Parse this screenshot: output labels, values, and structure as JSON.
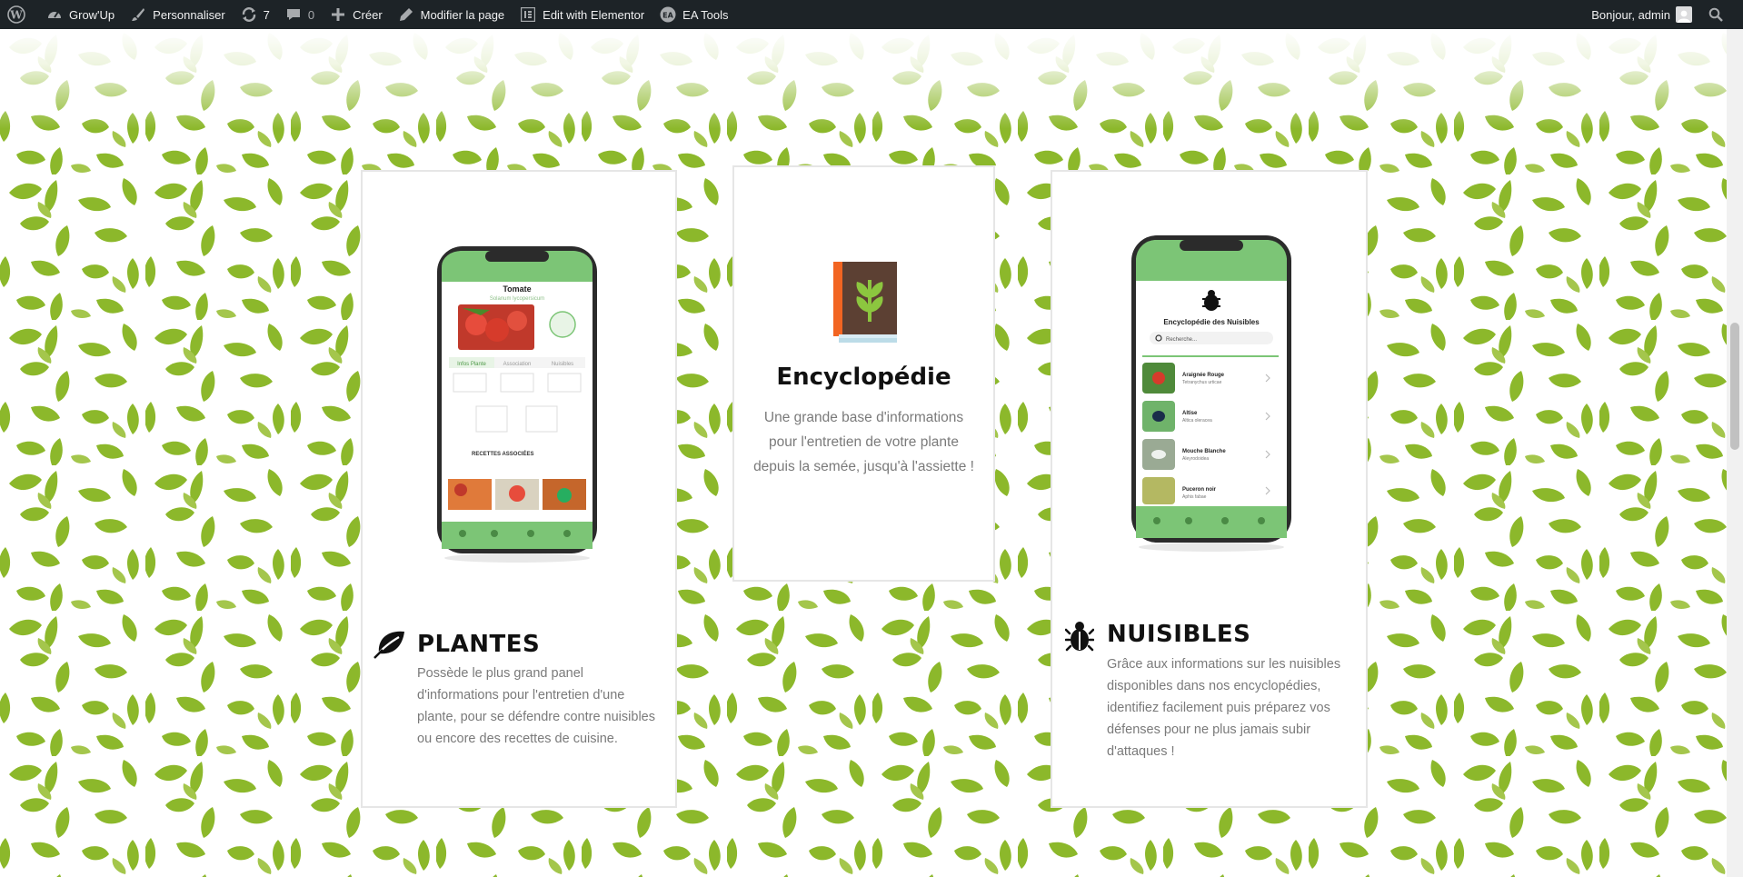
{
  "adminbar": {
    "site_name": "Grow'Up",
    "customize": "Personnaliser",
    "updates_count": "7",
    "comments_count": "0",
    "new": "Créer",
    "edit_page": "Modifier la page",
    "elementor": "Edit with Elementor",
    "ea_tools": "EA Tools",
    "greeting": "Bonjour, admin"
  },
  "cards": {
    "plantes": {
      "title": "PLANTES",
      "text": "Possède le plus grand panel d'informations pour l'entretien d'une plante, pour se défendre contre nuisibles ou encore des recettes de cuisine.",
      "phone": {
        "plant_name": "Tomate",
        "latin_name": "Solanum lycopersicum",
        "tabs": [
          "Infos Plante",
          "Association",
          "Nuisibles"
        ],
        "recipes_label": "RECETTES ASSOCIÉES"
      }
    },
    "encyclopedie": {
      "title": "Encyclopédie",
      "text": "Une grande base d'informations pour l'entretien de votre plante depuis la semée, jusqu'à l'assiette !"
    },
    "nuisibles": {
      "title": "NUISIBLES",
      "text": "Grâce aux informations sur les nuisibles disponibles dans nos encyclopédies, identifiez facilement puis préparez vos défenses pour ne plus jamais subir d'attaques !",
      "phone": {
        "header": "Encyclopédie des Nuisibles",
        "search_placeholder": "Recherche...",
        "items": [
          {
            "name": "Araignée Rouge",
            "latin": "Tetranychus urticae"
          },
          {
            "name": "Altise",
            "latin": "Altica oleracea"
          },
          {
            "name": "Mouche Blanche",
            "latin": "Aleyrodoidea"
          },
          {
            "name": "Puceron noir",
            "latin": "Aphis fabae"
          }
        ]
      }
    }
  },
  "colors": {
    "leaf_green": "#8cb82b",
    "app_green": "#7cc576",
    "admin_bar": "#1d2327"
  }
}
